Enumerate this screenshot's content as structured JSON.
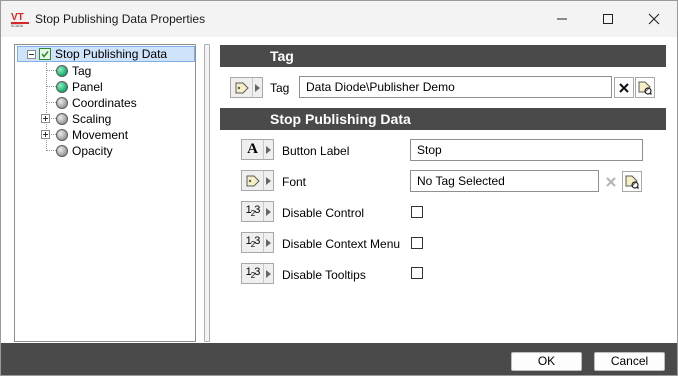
{
  "window": {
    "title": "Stop Publishing Data Properties",
    "icon": "vtscada-logo-icon",
    "controls": [
      "minimize-icon",
      "maximize-icon",
      "close-icon"
    ]
  },
  "tree": {
    "root": "Stop Publishing Data",
    "items": [
      {
        "label": "Tag",
        "status": "green"
      },
      {
        "label": "Panel",
        "status": "green"
      },
      {
        "label": "Coordinates",
        "status": "gray"
      },
      {
        "label": "Scaling",
        "status": "gray",
        "expandable": true
      },
      {
        "label": "Movement",
        "status": "gray",
        "expandable": true
      },
      {
        "label": "Opacity",
        "status": "gray"
      }
    ]
  },
  "sections": {
    "tag": {
      "header": "Tag",
      "field_label": "Tag",
      "field_value": "Data Diode\\Publisher Demo"
    },
    "stop_publishing": {
      "header": "Stop Publishing Data",
      "button_label": {
        "label": "Button Label",
        "value": "Stop"
      },
      "font": {
        "label": "Font",
        "value": "No Tag Selected"
      },
      "disable_control": {
        "label": "Disable Control",
        "checked": false
      },
      "disable_context_menu": {
        "label": "Disable Context Menu",
        "checked": false
      },
      "disable_tooltips": {
        "label": "Disable Tooltips",
        "checked": false
      }
    }
  },
  "footer": {
    "ok_label": "OK",
    "cancel_label": "Cancel"
  },
  "colors": {
    "header_bg": "#4a4a4a",
    "selection_bg": "#cfe3fa",
    "status_green": "#13a86a"
  }
}
